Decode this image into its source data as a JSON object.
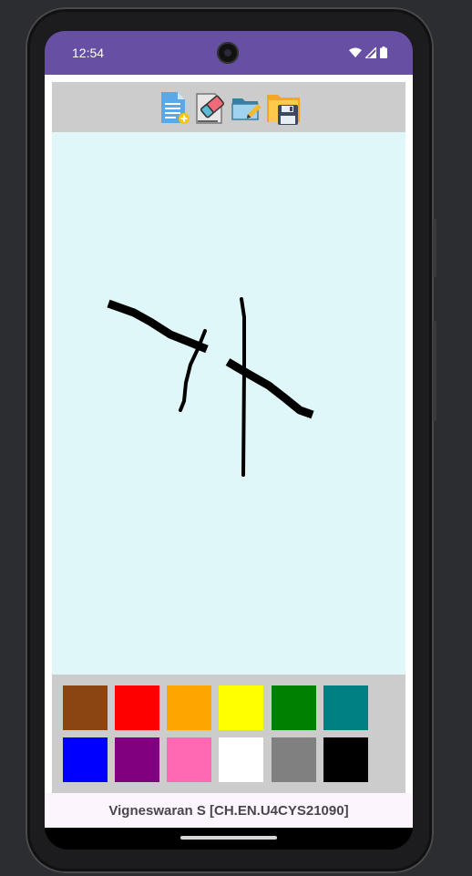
{
  "status_bar": {
    "time": "12:54",
    "icons": [
      "wifi-icon",
      "signal-icon",
      "battery-icon"
    ]
  },
  "toolbar": {
    "tools": [
      {
        "name": "new-file",
        "icon": "new-document-icon"
      },
      {
        "name": "eraser",
        "icon": "eraser-icon"
      },
      {
        "name": "open-folder",
        "icon": "open-folder-icon"
      },
      {
        "name": "save",
        "icon": "save-floppy-icon"
      }
    ]
  },
  "canvas": {
    "background": "#e0f7fa",
    "stroke_color": "#000000"
  },
  "palette": {
    "colors": [
      {
        "name": "brown",
        "hex": "#8b4513"
      },
      {
        "name": "red",
        "hex": "#ff0000"
      },
      {
        "name": "orange",
        "hex": "#ffa500"
      },
      {
        "name": "yellow",
        "hex": "#ffff00"
      },
      {
        "name": "green",
        "hex": "#008000"
      },
      {
        "name": "teal",
        "hex": "#008080"
      },
      {
        "name": "blue",
        "hex": "#0000ff"
      },
      {
        "name": "purple",
        "hex": "#800080"
      },
      {
        "name": "pink",
        "hex": "#ff69b4"
      },
      {
        "name": "white",
        "hex": "#ffffff"
      },
      {
        "name": "gray",
        "hex": "#808080"
      },
      {
        "name": "black",
        "hex": "#000000"
      }
    ]
  },
  "footer": {
    "text": "Vigneswaran S [CH.EN.U4CYS21090]"
  },
  "theme": {
    "status_bar_color": "#6750a4",
    "toolbar_color": "#cccccc"
  }
}
